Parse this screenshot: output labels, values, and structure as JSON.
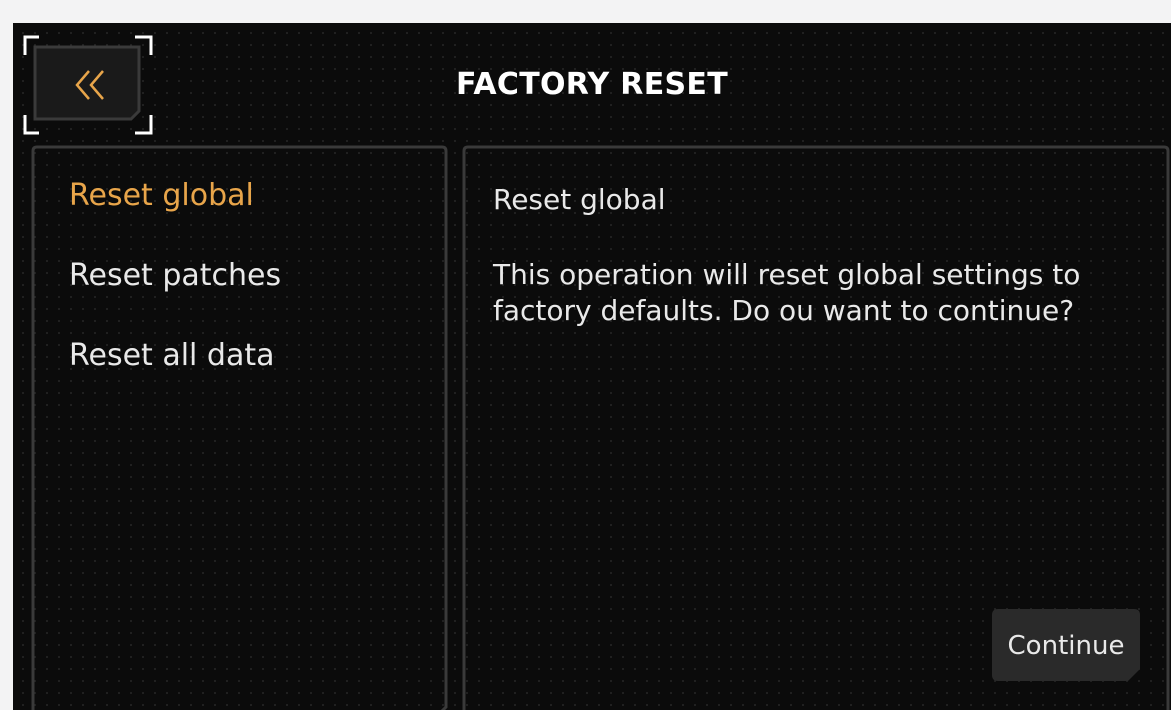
{
  "header": {
    "title": "FACTORY RESET",
    "back_icon": "double-chevron-left-icon"
  },
  "menu": {
    "items": [
      {
        "label": "Reset global",
        "active": true
      },
      {
        "label": "Reset patches",
        "active": false
      },
      {
        "label": "Reset all data",
        "active": false
      }
    ]
  },
  "detail": {
    "heading": "Reset global",
    "body": "This operation will reset global settings to factory defaults. Do ou want to continue?",
    "continue_label": "Continue"
  },
  "colors": {
    "accent": "#e8a54a",
    "background": "#0b0b0b",
    "text": "#e9e9e9",
    "panel_border": "#3a3a3a",
    "button_fill": "#2a2a2a"
  }
}
